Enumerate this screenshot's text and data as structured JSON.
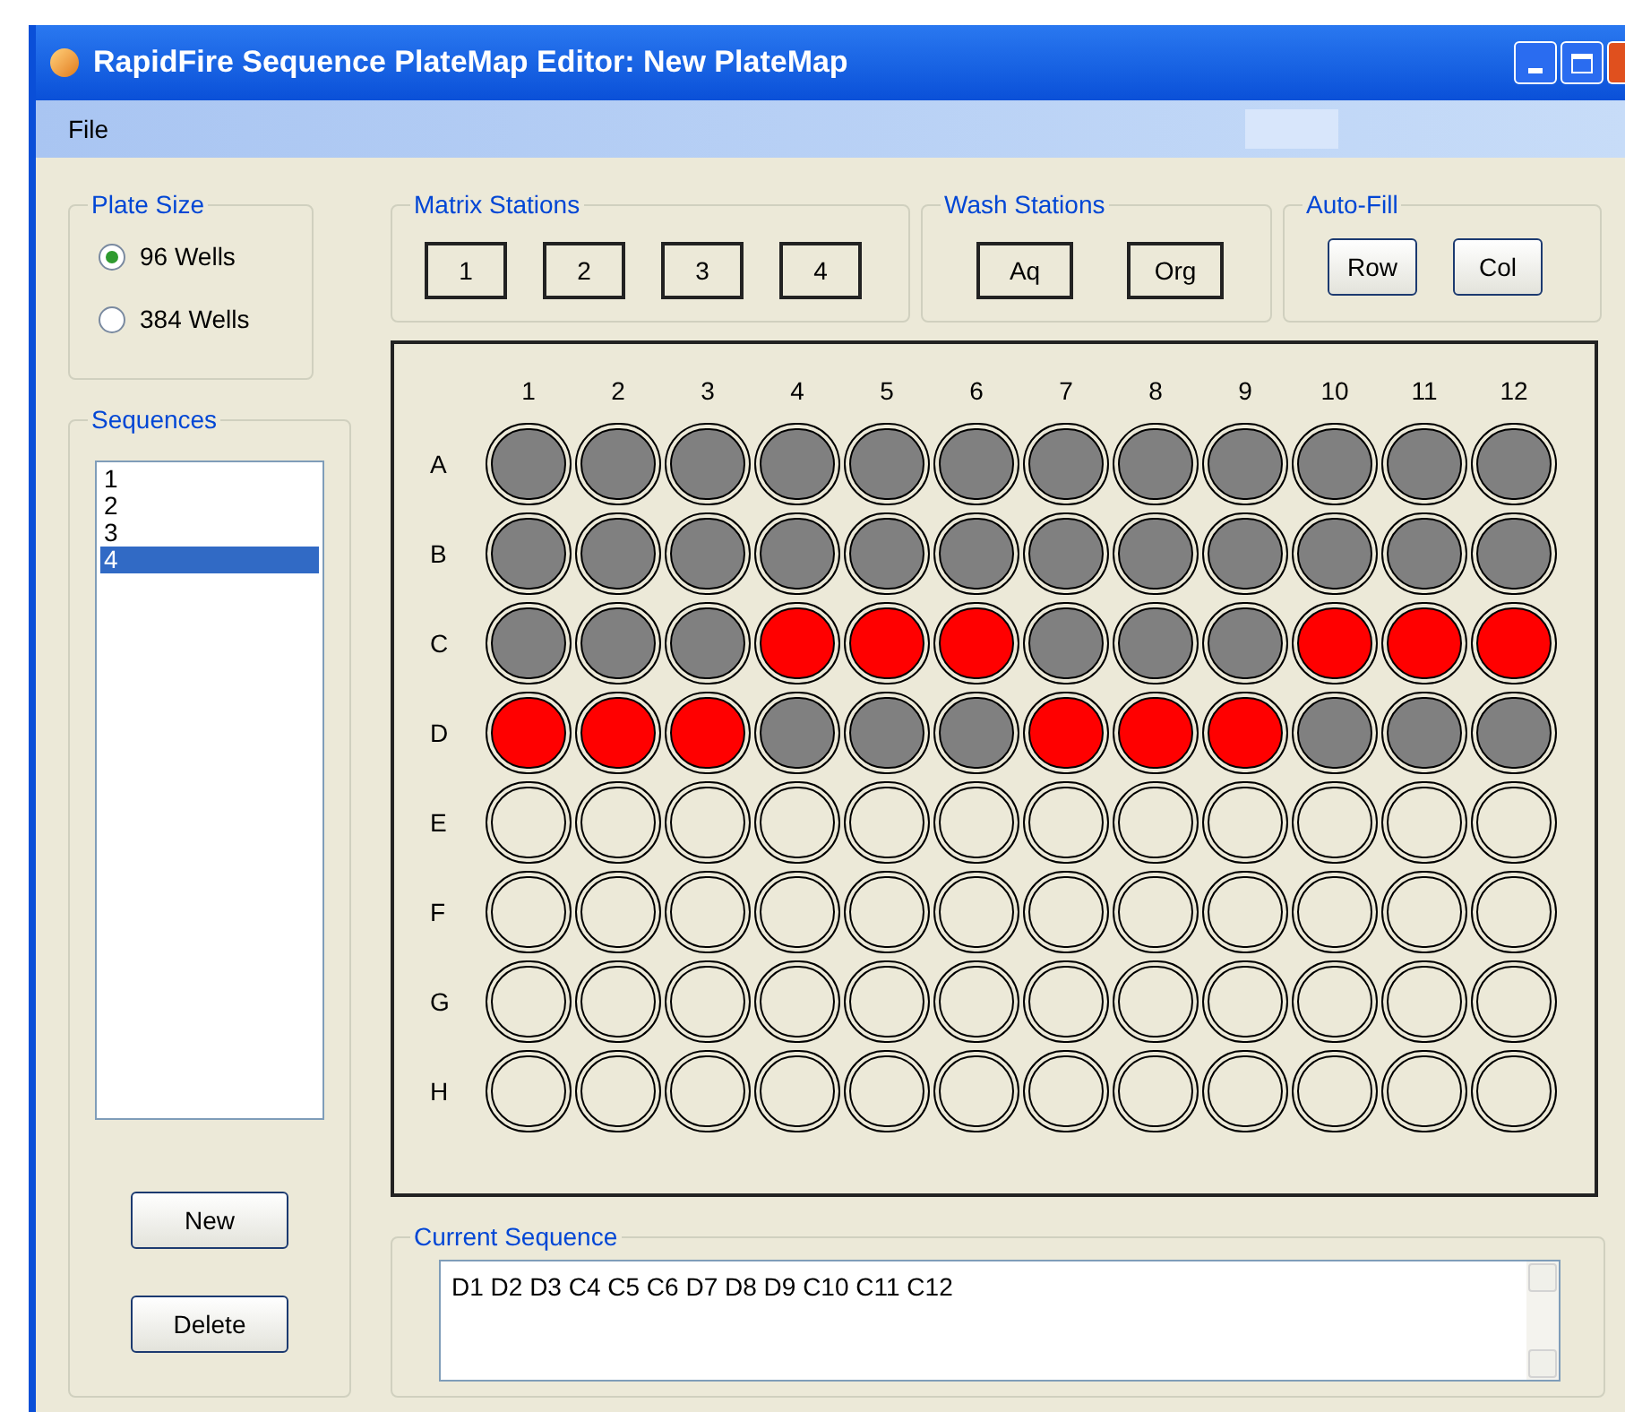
{
  "window": {
    "title": "RapidFire Sequence PlateMap Editor: New PlateMap"
  },
  "menu": [
    "File"
  ],
  "plate_size": {
    "title": "Plate Size",
    "options": [
      {
        "label": "96 Wells",
        "selected": true
      },
      {
        "label": "384 Wells",
        "selected": false
      }
    ]
  },
  "sequences": {
    "title": "Sequences",
    "items": [
      {
        "label": "1",
        "selected": false
      },
      {
        "label": "2",
        "selected": false
      },
      {
        "label": "3",
        "selected": false
      },
      {
        "label": "4",
        "selected": true
      }
    ],
    "buttons": [
      "New",
      "Delete"
    ]
  },
  "matrix_stations": {
    "title": "Matrix Stations",
    "buttons": [
      "1",
      "2",
      "3",
      "4"
    ]
  },
  "wash_stations": {
    "title": "Wash Stations",
    "buttons": [
      "Aq",
      "Org"
    ]
  },
  "auto_fill": {
    "title": "Auto-Fill",
    "buttons": [
      "Row",
      "Col"
    ]
  },
  "plate": {
    "columns": [
      "1",
      "2",
      "3",
      "4",
      "5",
      "6",
      "7",
      "8",
      "9",
      "10",
      "11",
      "12"
    ],
    "rows": [
      {
        "label": "A",
        "wells": [
          {
            "kind": "used"
          },
          {
            "kind": "used"
          },
          {
            "kind": "used"
          },
          {
            "kind": "used"
          },
          {
            "kind": "used"
          },
          {
            "kind": "used"
          },
          {
            "kind": "used"
          },
          {
            "kind": "used"
          },
          {
            "kind": "used"
          },
          {
            "kind": "used"
          },
          {
            "kind": "used"
          },
          {
            "kind": "used"
          }
        ]
      },
      {
        "label": "B",
        "wells": [
          {
            "kind": "used"
          },
          {
            "kind": "used"
          },
          {
            "kind": "used"
          },
          {
            "kind": "used"
          },
          {
            "kind": "used"
          },
          {
            "kind": "used"
          },
          {
            "kind": "used"
          },
          {
            "kind": "used"
          },
          {
            "kind": "used"
          },
          {
            "kind": "used"
          },
          {
            "kind": "used"
          },
          {
            "kind": "used"
          }
        ]
      },
      {
        "label": "C",
        "wells": [
          {
            "kind": "used"
          },
          {
            "kind": "used"
          },
          {
            "kind": "used"
          },
          {
            "kind": "selected"
          },
          {
            "kind": "selected"
          },
          {
            "kind": "selected"
          },
          {
            "kind": "used"
          },
          {
            "kind": "used"
          },
          {
            "kind": "used"
          },
          {
            "kind": "selected"
          },
          {
            "kind": "selected"
          },
          {
            "kind": "selected"
          }
        ]
      },
      {
        "label": "D",
        "wells": [
          {
            "kind": "selected"
          },
          {
            "kind": "selected"
          },
          {
            "kind": "selected"
          },
          {
            "kind": "used"
          },
          {
            "kind": "used"
          },
          {
            "kind": "used"
          },
          {
            "kind": "selected"
          },
          {
            "kind": "selected"
          },
          {
            "kind": "selected"
          },
          {
            "kind": "used"
          },
          {
            "kind": "used"
          },
          {
            "kind": "used"
          }
        ]
      },
      {
        "label": "E",
        "wells": [
          {
            "kind": "empty"
          },
          {
            "kind": "empty"
          },
          {
            "kind": "empty"
          },
          {
            "kind": "empty"
          },
          {
            "kind": "empty"
          },
          {
            "kind": "empty"
          },
          {
            "kind": "empty"
          },
          {
            "kind": "empty"
          },
          {
            "kind": "empty"
          },
          {
            "kind": "empty"
          },
          {
            "kind": "empty"
          },
          {
            "kind": "empty"
          }
        ]
      },
      {
        "label": "F",
        "wells": [
          {
            "kind": "empty"
          },
          {
            "kind": "empty"
          },
          {
            "kind": "empty"
          },
          {
            "kind": "empty"
          },
          {
            "kind": "empty"
          },
          {
            "kind": "empty"
          },
          {
            "kind": "empty"
          },
          {
            "kind": "empty"
          },
          {
            "kind": "empty"
          },
          {
            "kind": "empty"
          },
          {
            "kind": "empty"
          },
          {
            "kind": "empty"
          }
        ]
      },
      {
        "label": "G",
        "wells": [
          {
            "kind": "empty"
          },
          {
            "kind": "empty"
          },
          {
            "kind": "empty"
          },
          {
            "kind": "empty"
          },
          {
            "kind": "empty"
          },
          {
            "kind": "empty"
          },
          {
            "kind": "empty"
          },
          {
            "kind": "empty"
          },
          {
            "kind": "empty"
          },
          {
            "kind": "empty"
          },
          {
            "kind": "empty"
          },
          {
            "kind": "empty"
          }
        ]
      },
      {
        "label": "H",
        "wells": [
          {
            "kind": "empty"
          },
          {
            "kind": "empty"
          },
          {
            "kind": "empty"
          },
          {
            "kind": "empty"
          },
          {
            "kind": "empty"
          },
          {
            "kind": "empty"
          },
          {
            "kind": "empty"
          },
          {
            "kind": "empty"
          },
          {
            "kind": "empty"
          },
          {
            "kind": "empty"
          },
          {
            "kind": "empty"
          },
          {
            "kind": "empty"
          }
        ]
      }
    ]
  },
  "current_sequence": {
    "title": "Current Sequence",
    "value": "D1 D2 D3 C4 C5 C6 D7 D8 D9 C10 C11 C12"
  }
}
